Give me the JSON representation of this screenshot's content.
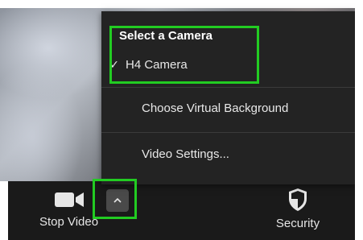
{
  "camera_menu": {
    "section_title": "Select a Camera",
    "cameras": [
      {
        "label": "H4 Camera",
        "checked": true,
        "check_glyph": "✓"
      }
    ],
    "choose_virtual_background_label": "Choose Virtual Background",
    "video_settings_label": "Video Settings..."
  },
  "toolbar": {
    "stop_video_label": "Stop Video",
    "stop_video_icon": "video-camera-icon",
    "options_caret_icon": "caret-up-icon",
    "security_label": "Security",
    "security_icon": "shield-icon"
  },
  "colors": {
    "highlight": "#22cc22",
    "menu_bg": "#232323",
    "toolbar_bg": "#1a1a1a"
  }
}
